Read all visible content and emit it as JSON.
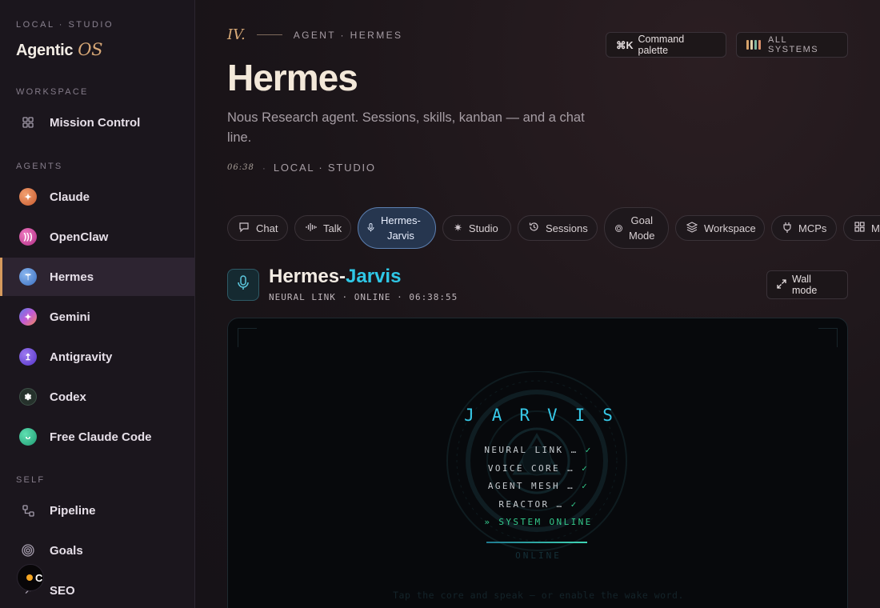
{
  "sidebar": {
    "kicker": "LOCAL · STUDIO",
    "brand": "Agentic",
    "brand_accent": "OS",
    "sections": {
      "workspace": "WORKSPACE",
      "agents": "AGENTS",
      "self": "SELF"
    },
    "workspace_items": [
      {
        "label": "Mission Control",
        "icon": "grid-icon"
      }
    ],
    "agent_items": [
      {
        "label": "Claude",
        "icon": "claude-icon",
        "color": "#e07a4a"
      },
      {
        "label": "OpenClaw",
        "icon": "openclaw-icon",
        "color": "#d94aa0"
      },
      {
        "label": "Hermes",
        "icon": "hermes-icon",
        "color": "#5b8fd6",
        "active": true
      },
      {
        "label": "Gemini",
        "icon": "gemini-icon",
        "color": "#8a6ae0"
      },
      {
        "label": "Antigravity",
        "icon": "antigravity-icon",
        "color": "#6a4ae0"
      },
      {
        "label": "Codex",
        "icon": "codex-icon",
        "color": "#2e3a34"
      },
      {
        "label": "Free Claude Code",
        "icon": "free-claude-code-icon",
        "color": "#2fb38a"
      }
    ],
    "self_items": [
      {
        "label": "Pipeline",
        "icon": "pipeline-icon"
      },
      {
        "label": "Goals",
        "icon": "target-icon"
      },
      {
        "label": "SEO",
        "icon": "seo-icon"
      }
    ],
    "floating_badge": "C"
  },
  "header": {
    "chapter": "IV.",
    "kicker": "AGENT · HERMES",
    "title": "Hermes",
    "subtitle": "Nous Research agent. Sessions, skills, kanban — and a chat line.",
    "time": "06:38",
    "location": "LOCAL · STUDIO",
    "command_palette_key": "⌘K",
    "command_palette_label": "Command palette",
    "systems_label": "ALL SYSTEMS",
    "systems_colors": [
      "#d6a26a",
      "#e0cfa8",
      "#7fb6a0",
      "#d98f6a"
    ]
  },
  "tabs": [
    {
      "label": "Chat",
      "icon": "chat-icon"
    },
    {
      "label": "Talk",
      "icon": "waveform-icon"
    },
    {
      "label": "Hermes-\nJarvis",
      "icon": "mic-icon",
      "active": true
    },
    {
      "label": "Studio",
      "icon": "sparkles-icon"
    },
    {
      "label": "Sessions",
      "icon": "history-icon"
    },
    {
      "label": "Goal\nMode",
      "icon": "target-icon"
    },
    {
      "label": "Workspace",
      "icon": "layers-icon"
    },
    {
      "label": "MCPs",
      "icon": "plug-icon"
    },
    {
      "label": "Ma",
      "icon": "grid-icon"
    }
  ],
  "jarvis": {
    "title_prefix": "Hermes-",
    "title_accent": "Jarvis",
    "status": "NEURAL LINK · ONLINE · 06:38:55",
    "wall_mode": "Wall mode",
    "wordmark": "JARVIS",
    "boot_lines": [
      {
        "text": "NEURAL LINK …",
        "check": "✓"
      },
      {
        "text": "VOICE CORE …",
        "check": "✓"
      },
      {
        "text": "AGENT MESH …",
        "check": "✓"
      },
      {
        "text": "REACTOR …",
        "check": "✓"
      }
    ],
    "system_online": "» SYSTEM ONLINE",
    "ghost_status": "ONLINE",
    "hint": "Tap the core and speak — or enable the wake word."
  }
}
